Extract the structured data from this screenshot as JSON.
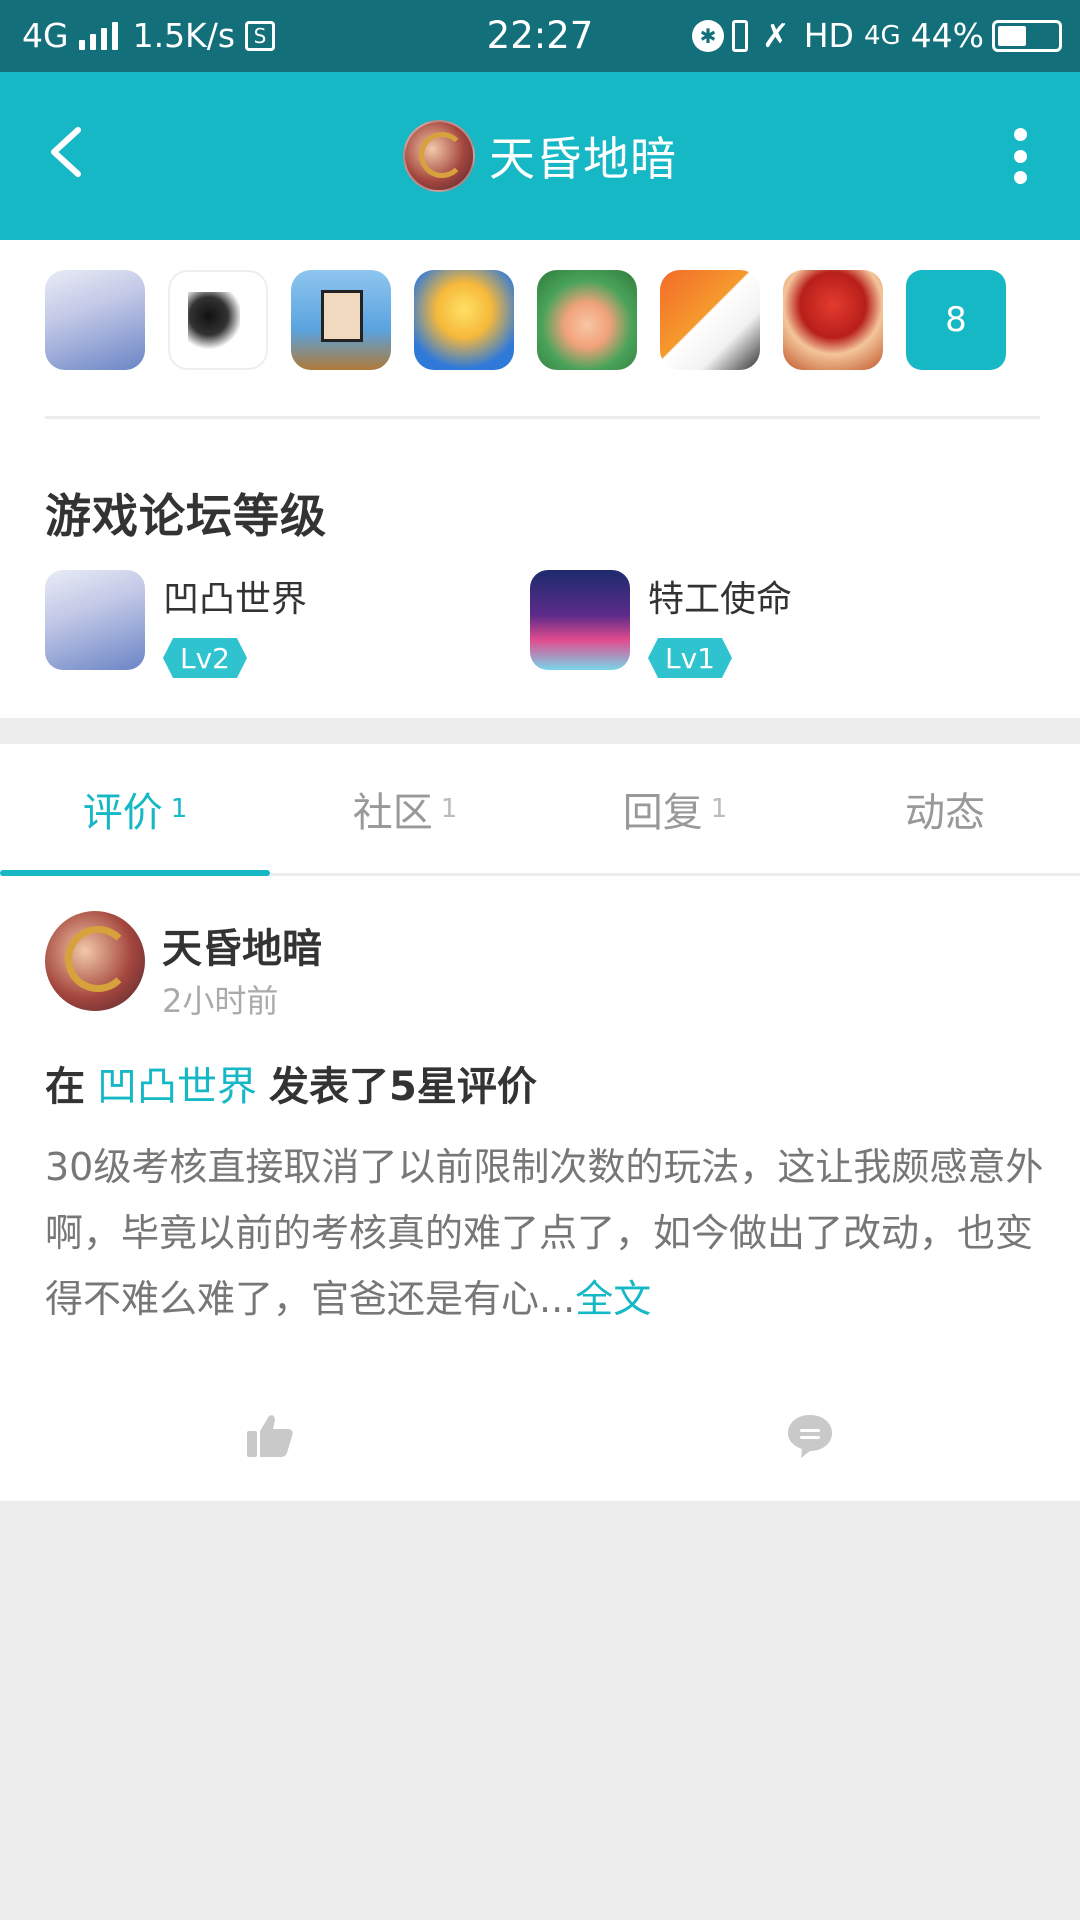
{
  "status_bar": {
    "network": "4G",
    "speed": "1.5K/s",
    "sim_icon": "sim-card-icon",
    "time": "22:27",
    "hd": "HD",
    "network_right": "4G",
    "battery": "44%"
  },
  "header": {
    "title": "天昏地暗",
    "back_icon": "back-arrow-icon",
    "more_icon": "more-vertical-icon"
  },
  "games": {
    "more_count": "8"
  },
  "forum_levels": {
    "heading": "游戏论坛等级",
    "items": [
      {
        "name": "凹凸世界",
        "level": "Lv2"
      },
      {
        "name": "特工使命",
        "level": "Lv1"
      }
    ]
  },
  "tabs": [
    {
      "label": "评价",
      "count": "1"
    },
    {
      "label": "社区",
      "count": "1"
    },
    {
      "label": "回复",
      "count": "1"
    },
    {
      "label": "动态",
      "count": ""
    }
  ],
  "post": {
    "author": "天昏地暗",
    "time": "2小时前",
    "headline_prefix": "在",
    "headline_game": "凹凸世界",
    "headline_suffix": "发表了5星评价",
    "body": "30级考核直接取消了以前限制次数的玩法，这让我颇感意外啊，毕竟以前的考核真的难了点了，如今做出了改动，也变得不难么难了，官爸还是有心...",
    "more_label": "全文"
  },
  "colors": {
    "accent": "#17b8c6",
    "status_bar": "#13707a"
  }
}
